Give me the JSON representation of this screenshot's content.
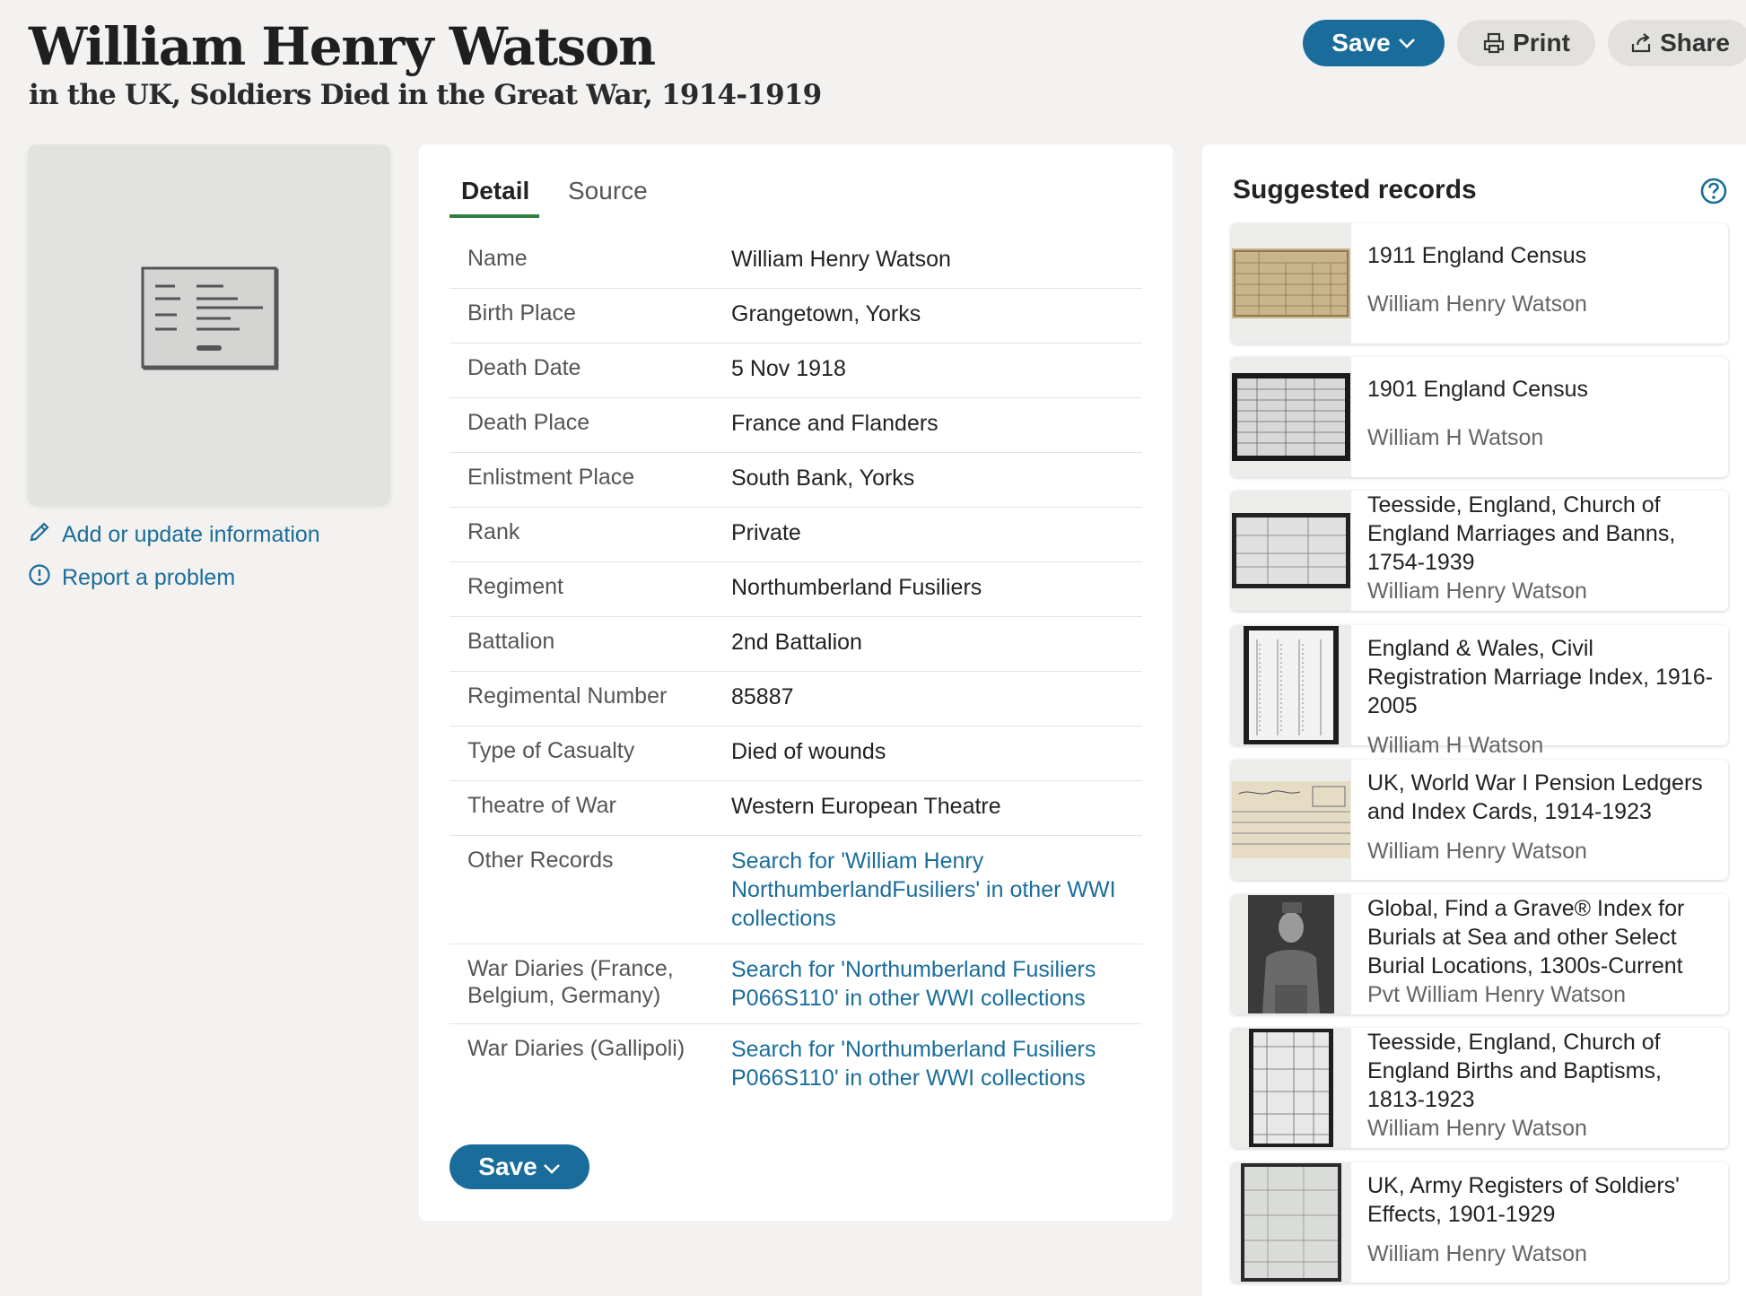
{
  "header": {
    "title": "William Henry Watson",
    "subtitle": "in the UK, Soldiers Died in the Great War, 1914-1919",
    "save_label": "Save",
    "print_label": "Print",
    "share_label": "Share"
  },
  "sidebar": {
    "add_label": "Add or update information",
    "report_label": "Report a problem"
  },
  "tabs": {
    "detail": "Detail",
    "source": "Source"
  },
  "details": [
    {
      "label": "Name",
      "value": "William Henry Watson"
    },
    {
      "label": "Birth Place",
      "value": "Grangetown, Yorks"
    },
    {
      "label": "Death Date",
      "value": "5 Nov 1918"
    },
    {
      "label": "Death Place",
      "value": "France and Flanders"
    },
    {
      "label": "Enlistment Place",
      "value": "South Bank, Yorks"
    },
    {
      "label": "Rank",
      "value": "Private"
    },
    {
      "label": "Regiment",
      "value": "Northumberland Fusiliers"
    },
    {
      "label": "Battalion",
      "value": "2nd Battalion"
    },
    {
      "label": "Regimental Number",
      "value": "85887"
    },
    {
      "label": "Type of Casualty",
      "value": "Died of wounds"
    },
    {
      "label": "Theatre of War",
      "value": "Western European Theatre"
    },
    {
      "label": "Other Records",
      "value": "Search for 'William Henry NorthumberlandFusiliers' in other WWI collections"
    },
    {
      "label": "War Diaries (France, Belgium, Germany)",
      "value": "Search for 'Northumberland Fusiliers P066S110' in other WWI collections"
    },
    {
      "label": "War Diaries (Gallipoli)",
      "value": "Search for 'Northumberland Fusiliers P066S110' in other WWI collections"
    }
  ],
  "bottom_save_label": "Save",
  "suggested": {
    "title": "Suggested records",
    "items": [
      {
        "name": "1911 England Census",
        "person": "William Henry Watson"
      },
      {
        "name": "1901 England Census",
        "person": "William H Watson"
      },
      {
        "name": "Teesside, England, Church of England Marriages and Banns, 1754-1939",
        "person": "William Henry Watson"
      },
      {
        "name": "England & Wales, Civil Registration Marriage Index, 1916-2005",
        "person": "William H Watson"
      },
      {
        "name": "UK, World War I Pension Ledgers and Index Cards, 1914-1923",
        "person": "William Henry Watson"
      },
      {
        "name": "Global, Find a Grave® Index for Burials at Sea and other Select Burial Locations, 1300s-Current",
        "person": "Pvt William Henry Watson"
      },
      {
        "name": "Teesside, England, Church of England Births and Baptisms, 1813-1923",
        "person": "William Henry Watson"
      },
      {
        "name": "UK, Army Registers of Soldiers' Effects, 1901-1929",
        "person": "William Henry Watson"
      }
    ]
  },
  "colors": {
    "accent": "#1a6d9a",
    "tab_underline": "#2f7d3f",
    "background": "#f3f2f0"
  }
}
